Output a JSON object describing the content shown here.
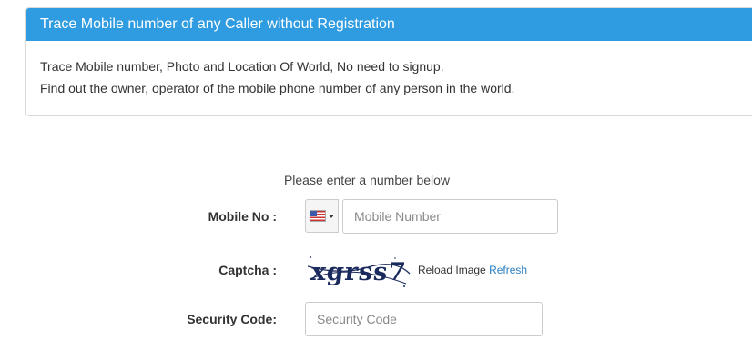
{
  "panel": {
    "title": "Trace Mobile number of any Caller without Registration",
    "line1": "Trace Mobile number, Photo and Location Of World, No need to signup.",
    "line2": "Find out the owner, operator of the mobile phone number of any person in the world."
  },
  "form": {
    "prompt": "Please enter a number below",
    "mobile_label": "Mobile No :",
    "mobile_placeholder": "Mobile Number",
    "country_icon": "us-flag-icon",
    "captcha_label": "Captcha :",
    "captcha_text": "xgrss7",
    "reload_label": "Reload Image",
    "refresh_link": "Refresh",
    "security_label": "Security Code:",
    "security_placeholder": "Security Code"
  },
  "colors": {
    "heading_bg": "#2f9be0",
    "link": "#2a7ec1"
  }
}
